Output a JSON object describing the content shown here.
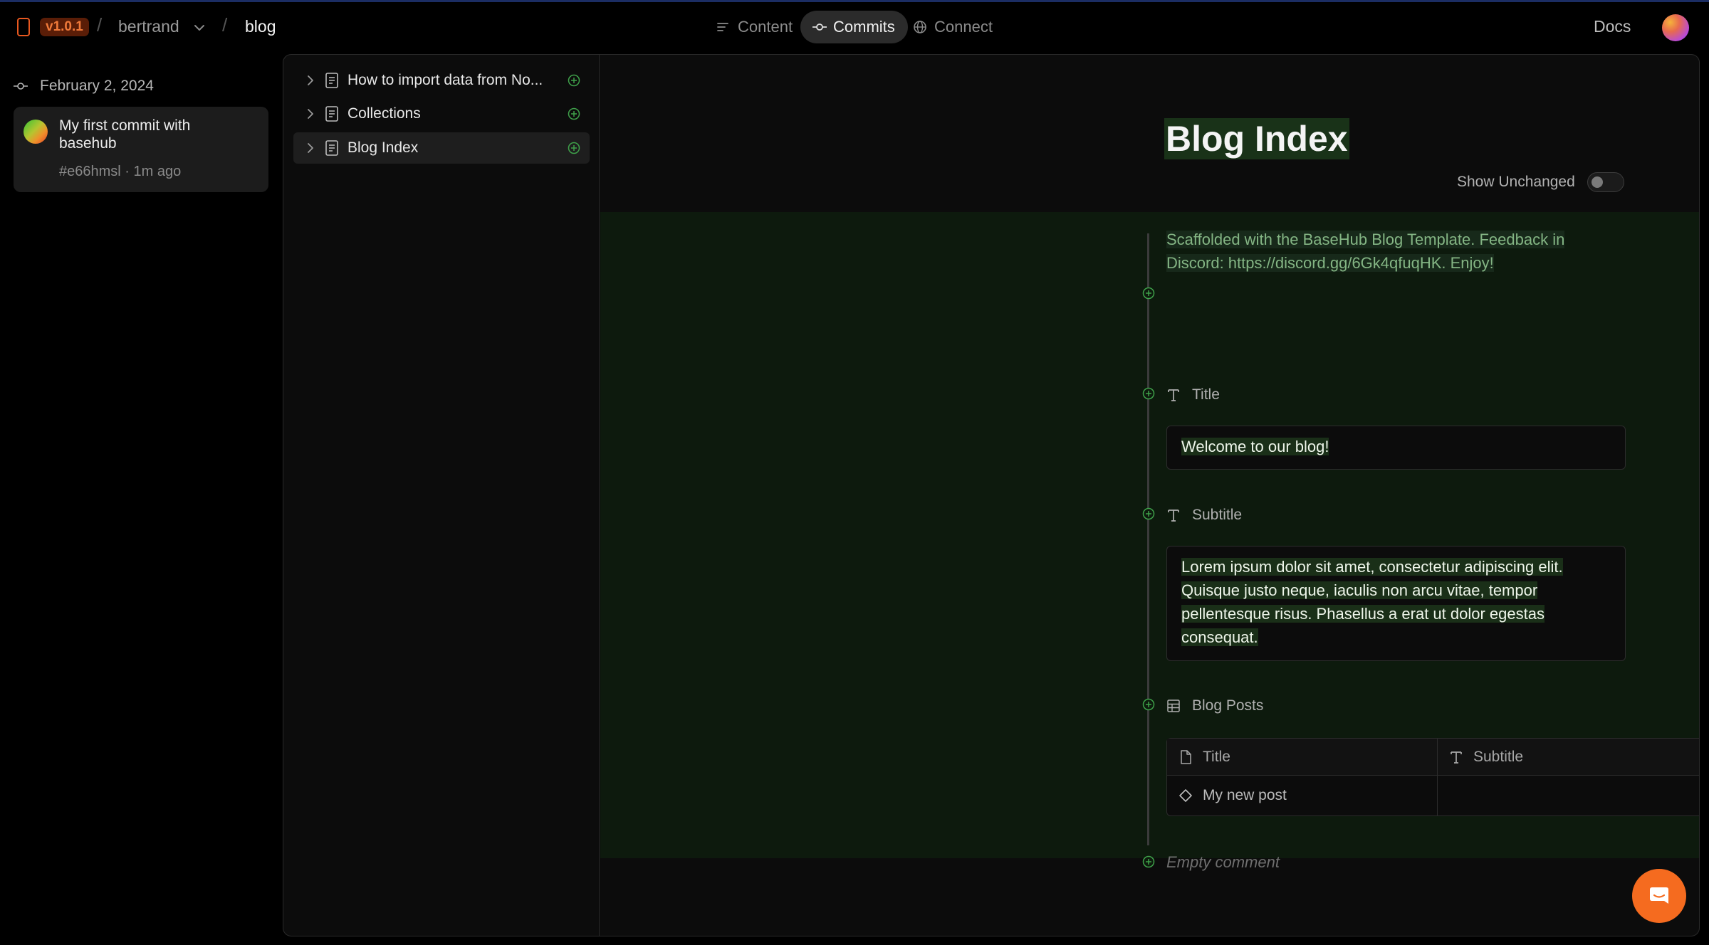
{
  "header": {
    "version": "v1.0.1",
    "separator": "/",
    "user": "bertrand",
    "repo": "blog",
    "tabs": [
      {
        "label": "Content",
        "icon": "lines-icon",
        "active": false
      },
      {
        "label": "Commits",
        "icon": "commit-icon",
        "active": true
      },
      {
        "label": "Connect",
        "icon": "globe-icon",
        "active": false
      }
    ],
    "docs_label": "Docs"
  },
  "commits": {
    "date": "February 2, 2024",
    "items": [
      {
        "message": "My first commit with basehub",
        "hash": "#e66hmsl",
        "time": "1m ago",
        "meta": "#e66hmsl · 1m ago"
      }
    ]
  },
  "tree": {
    "items": [
      {
        "label": "How to import data from No...",
        "selected": false
      },
      {
        "label": "Collections",
        "selected": false
      },
      {
        "label": "Blog Index",
        "selected": true
      }
    ]
  },
  "document": {
    "title": "Blog Index",
    "show_unchanged_label": "Show Unchanged",
    "show_unchanged": false,
    "description": "Scaffolded with the BaseHub Blog Template. Feedback in Discord: https://discord.gg/6Gk4qfuqHK. Enjoy!",
    "fields": [
      {
        "label": "Title",
        "value": "Welcome to our blog!"
      },
      {
        "label": "Subtitle",
        "value": "Lorem ipsum dolor sit amet, consectetur adipiscing elit. Quisque justo neque, iaculis non arcu vitae, tempor pellentesque risus. Phasellus a erat ut dolor egestas consequat."
      }
    ],
    "blog_posts": {
      "label": "Blog Posts",
      "columns": [
        "Title",
        "Subtitle"
      ],
      "rows": [
        {
          "title": "My new post",
          "subtitle": ""
        }
      ]
    },
    "empty_comment": "Empty comment"
  },
  "colors": {
    "accent_orange": "#f56b1f",
    "added_green": "#3fa14a",
    "diff_bg": "#0d1a0d"
  }
}
